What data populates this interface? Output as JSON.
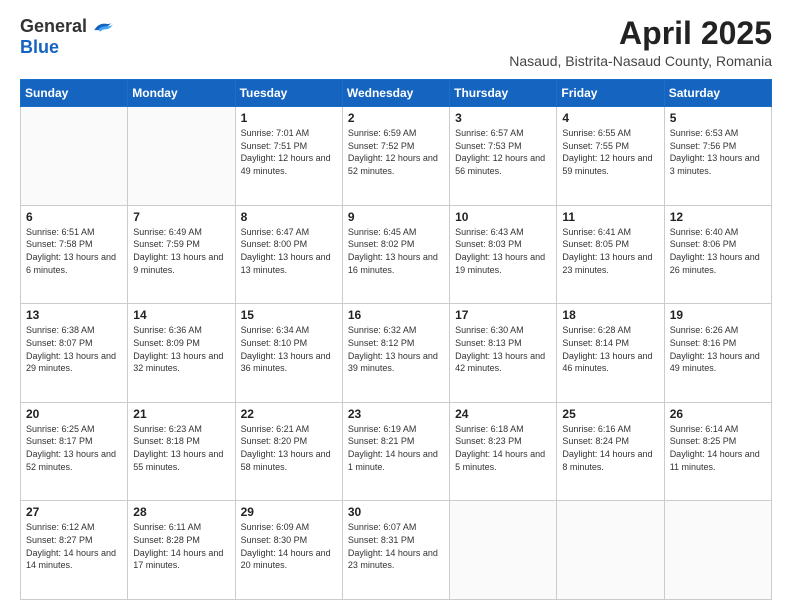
{
  "logo": {
    "general": "General",
    "blue": "Blue"
  },
  "title": "April 2025",
  "location": "Nasaud, Bistrita-Nasaud County, Romania",
  "days_of_week": [
    "Sunday",
    "Monday",
    "Tuesday",
    "Wednesday",
    "Thursday",
    "Friday",
    "Saturday"
  ],
  "weeks": [
    [
      {
        "day": "",
        "info": ""
      },
      {
        "day": "",
        "info": ""
      },
      {
        "day": "1",
        "info": "Sunrise: 7:01 AM\nSunset: 7:51 PM\nDaylight: 12 hours and 49 minutes."
      },
      {
        "day": "2",
        "info": "Sunrise: 6:59 AM\nSunset: 7:52 PM\nDaylight: 12 hours and 52 minutes."
      },
      {
        "day": "3",
        "info": "Sunrise: 6:57 AM\nSunset: 7:53 PM\nDaylight: 12 hours and 56 minutes."
      },
      {
        "day": "4",
        "info": "Sunrise: 6:55 AM\nSunset: 7:55 PM\nDaylight: 12 hours and 59 minutes."
      },
      {
        "day": "5",
        "info": "Sunrise: 6:53 AM\nSunset: 7:56 PM\nDaylight: 13 hours and 3 minutes."
      }
    ],
    [
      {
        "day": "6",
        "info": "Sunrise: 6:51 AM\nSunset: 7:58 PM\nDaylight: 13 hours and 6 minutes."
      },
      {
        "day": "7",
        "info": "Sunrise: 6:49 AM\nSunset: 7:59 PM\nDaylight: 13 hours and 9 minutes."
      },
      {
        "day": "8",
        "info": "Sunrise: 6:47 AM\nSunset: 8:00 PM\nDaylight: 13 hours and 13 minutes."
      },
      {
        "day": "9",
        "info": "Sunrise: 6:45 AM\nSunset: 8:02 PM\nDaylight: 13 hours and 16 minutes."
      },
      {
        "day": "10",
        "info": "Sunrise: 6:43 AM\nSunset: 8:03 PM\nDaylight: 13 hours and 19 minutes."
      },
      {
        "day": "11",
        "info": "Sunrise: 6:41 AM\nSunset: 8:05 PM\nDaylight: 13 hours and 23 minutes."
      },
      {
        "day": "12",
        "info": "Sunrise: 6:40 AM\nSunset: 8:06 PM\nDaylight: 13 hours and 26 minutes."
      }
    ],
    [
      {
        "day": "13",
        "info": "Sunrise: 6:38 AM\nSunset: 8:07 PM\nDaylight: 13 hours and 29 minutes."
      },
      {
        "day": "14",
        "info": "Sunrise: 6:36 AM\nSunset: 8:09 PM\nDaylight: 13 hours and 32 minutes."
      },
      {
        "day": "15",
        "info": "Sunrise: 6:34 AM\nSunset: 8:10 PM\nDaylight: 13 hours and 36 minutes."
      },
      {
        "day": "16",
        "info": "Sunrise: 6:32 AM\nSunset: 8:12 PM\nDaylight: 13 hours and 39 minutes."
      },
      {
        "day": "17",
        "info": "Sunrise: 6:30 AM\nSunset: 8:13 PM\nDaylight: 13 hours and 42 minutes."
      },
      {
        "day": "18",
        "info": "Sunrise: 6:28 AM\nSunset: 8:14 PM\nDaylight: 13 hours and 46 minutes."
      },
      {
        "day": "19",
        "info": "Sunrise: 6:26 AM\nSunset: 8:16 PM\nDaylight: 13 hours and 49 minutes."
      }
    ],
    [
      {
        "day": "20",
        "info": "Sunrise: 6:25 AM\nSunset: 8:17 PM\nDaylight: 13 hours and 52 minutes."
      },
      {
        "day": "21",
        "info": "Sunrise: 6:23 AM\nSunset: 8:18 PM\nDaylight: 13 hours and 55 minutes."
      },
      {
        "day": "22",
        "info": "Sunrise: 6:21 AM\nSunset: 8:20 PM\nDaylight: 13 hours and 58 minutes."
      },
      {
        "day": "23",
        "info": "Sunrise: 6:19 AM\nSunset: 8:21 PM\nDaylight: 14 hours and 1 minute."
      },
      {
        "day": "24",
        "info": "Sunrise: 6:18 AM\nSunset: 8:23 PM\nDaylight: 14 hours and 5 minutes."
      },
      {
        "day": "25",
        "info": "Sunrise: 6:16 AM\nSunset: 8:24 PM\nDaylight: 14 hours and 8 minutes."
      },
      {
        "day": "26",
        "info": "Sunrise: 6:14 AM\nSunset: 8:25 PM\nDaylight: 14 hours and 11 minutes."
      }
    ],
    [
      {
        "day": "27",
        "info": "Sunrise: 6:12 AM\nSunset: 8:27 PM\nDaylight: 14 hours and 14 minutes."
      },
      {
        "day": "28",
        "info": "Sunrise: 6:11 AM\nSunset: 8:28 PM\nDaylight: 14 hours and 17 minutes."
      },
      {
        "day": "29",
        "info": "Sunrise: 6:09 AM\nSunset: 8:30 PM\nDaylight: 14 hours and 20 minutes."
      },
      {
        "day": "30",
        "info": "Sunrise: 6:07 AM\nSunset: 8:31 PM\nDaylight: 14 hours and 23 minutes."
      },
      {
        "day": "",
        "info": ""
      },
      {
        "day": "",
        "info": ""
      },
      {
        "day": "",
        "info": ""
      }
    ]
  ]
}
